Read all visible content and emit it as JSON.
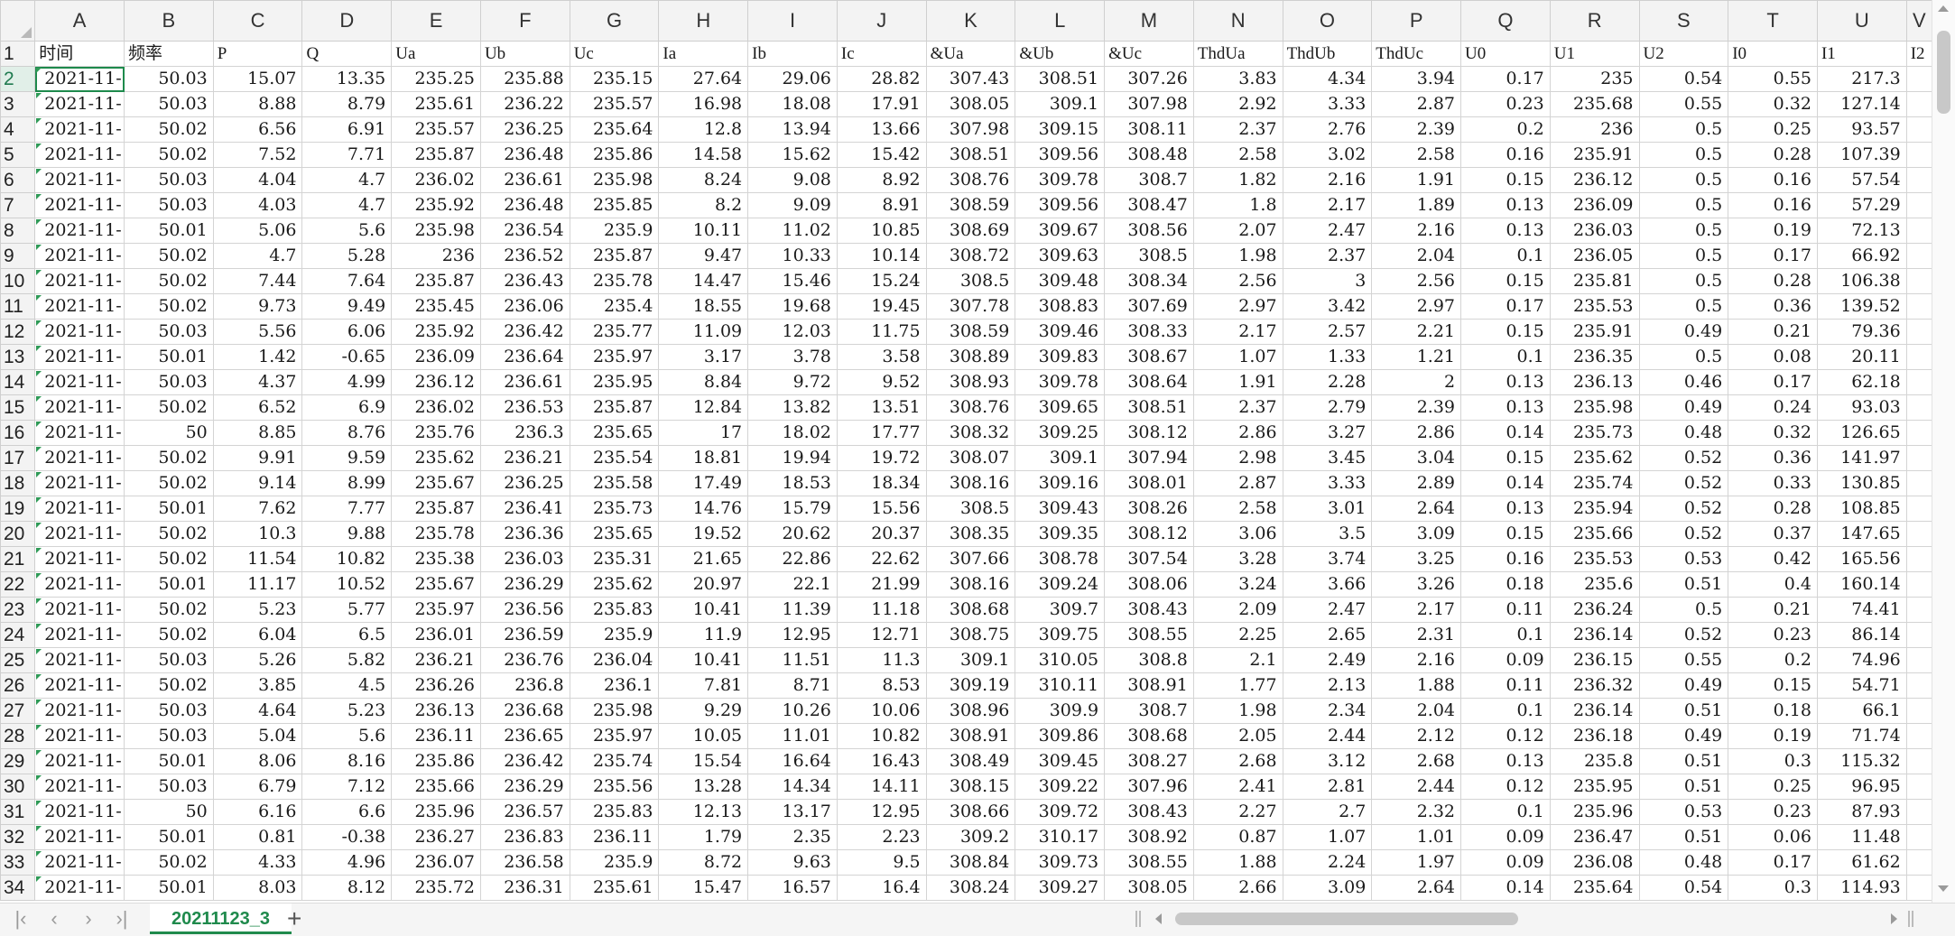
{
  "columns": [
    "A",
    "B",
    "C",
    "D",
    "E",
    "F",
    "G",
    "H",
    "I",
    "J",
    "K",
    "L",
    "M",
    "N",
    "O",
    "P",
    "Q",
    "R",
    "S",
    "T",
    "U",
    "V"
  ],
  "header_row": {
    "row": "1",
    "cells": [
      "时间",
      "频率",
      "P",
      "Q",
      "Ua",
      "Ub",
      "Uc",
      "Ia",
      "Ib",
      "Ic",
      "&Ua",
      "&Ub",
      "&Uc",
      "ThdUa",
      "ThdUb",
      "ThdUc",
      "U0",
      "U1",
      "U2",
      "I0",
      "I1",
      "I2"
    ]
  },
  "rows": [
    {
      "row": "2",
      "cells": [
        "2021-11-",
        "50.03",
        "15.07",
        "13.35",
        "235.25",
        "235.88",
        "235.15",
        "27.64",
        "29.06",
        "28.82",
        "307.43",
        "308.51",
        "307.26",
        "3.83",
        "4.34",
        "3.94",
        "0.17",
        "235",
        "0.54",
        "0.55",
        "217.3",
        ""
      ]
    },
    {
      "row": "3",
      "cells": [
        "2021-11-",
        "50.03",
        "8.88",
        "8.79",
        "235.61",
        "236.22",
        "235.57",
        "16.98",
        "18.08",
        "17.91",
        "308.05",
        "309.1",
        "307.98",
        "2.92",
        "3.33",
        "2.87",
        "0.23",
        "235.68",
        "0.55",
        "0.32",
        "127.14",
        ""
      ]
    },
    {
      "row": "4",
      "cells": [
        "2021-11-",
        "50.02",
        "6.56",
        "6.91",
        "235.57",
        "236.25",
        "235.64",
        "12.8",
        "13.94",
        "13.66",
        "307.98",
        "309.15",
        "308.11",
        "2.37",
        "2.76",
        "2.39",
        "0.2",
        "236",
        "0.5",
        "0.25",
        "93.57",
        ""
      ]
    },
    {
      "row": "5",
      "cells": [
        "2021-11-",
        "50.02",
        "7.52",
        "7.71",
        "235.87",
        "236.48",
        "235.86",
        "14.58",
        "15.62",
        "15.42",
        "308.51",
        "309.56",
        "308.48",
        "2.58",
        "3.02",
        "2.58",
        "0.16",
        "235.91",
        "0.5",
        "0.28",
        "107.39",
        ""
      ]
    },
    {
      "row": "6",
      "cells": [
        "2021-11-",
        "50.03",
        "4.04",
        "4.7",
        "236.02",
        "236.61",
        "235.98",
        "8.24",
        "9.08",
        "8.92",
        "308.76",
        "309.78",
        "308.7",
        "1.82",
        "2.16",
        "1.91",
        "0.15",
        "236.12",
        "0.5",
        "0.16",
        "57.54",
        ""
      ]
    },
    {
      "row": "7",
      "cells": [
        "2021-11-",
        "50.03",
        "4.03",
        "4.7",
        "235.92",
        "236.48",
        "235.85",
        "8.2",
        "9.09",
        "8.91",
        "308.59",
        "309.56",
        "308.47",
        "1.8",
        "2.17",
        "1.89",
        "0.13",
        "236.09",
        "0.5",
        "0.16",
        "57.29",
        ""
      ]
    },
    {
      "row": "8",
      "cells": [
        "2021-11-",
        "50.01",
        "5.06",
        "5.6",
        "235.98",
        "236.54",
        "235.9",
        "10.11",
        "11.02",
        "10.85",
        "308.69",
        "309.67",
        "308.56",
        "2.07",
        "2.47",
        "2.16",
        "0.13",
        "236.03",
        "0.5",
        "0.19",
        "72.13",
        ""
      ]
    },
    {
      "row": "9",
      "cells": [
        "2021-11-",
        "50.02",
        "4.7",
        "5.28",
        "236",
        "236.52",
        "235.87",
        "9.47",
        "10.33",
        "10.14",
        "308.72",
        "309.63",
        "308.5",
        "1.98",
        "2.37",
        "2.04",
        "0.1",
        "236.05",
        "0.5",
        "0.17",
        "66.92",
        ""
      ]
    },
    {
      "row": "10",
      "cells": [
        "2021-11-",
        "50.02",
        "7.44",
        "7.64",
        "235.87",
        "236.43",
        "235.78",
        "14.47",
        "15.46",
        "15.24",
        "308.5",
        "309.48",
        "308.34",
        "2.56",
        "3",
        "2.56",
        "0.15",
        "235.81",
        "0.5",
        "0.28",
        "106.38",
        ""
      ]
    },
    {
      "row": "11",
      "cells": [
        "2021-11-",
        "50.02",
        "9.73",
        "9.49",
        "235.45",
        "236.06",
        "235.4",
        "18.55",
        "19.68",
        "19.45",
        "307.78",
        "308.83",
        "307.69",
        "2.97",
        "3.42",
        "2.97",
        "0.17",
        "235.53",
        "0.5",
        "0.36",
        "139.52",
        ""
      ]
    },
    {
      "row": "12",
      "cells": [
        "2021-11-",
        "50.03",
        "5.56",
        "6.06",
        "235.92",
        "236.42",
        "235.77",
        "11.09",
        "12.03",
        "11.75",
        "308.59",
        "309.46",
        "308.33",
        "2.17",
        "2.57",
        "2.21",
        "0.15",
        "235.91",
        "0.49",
        "0.21",
        "79.36",
        ""
      ]
    },
    {
      "row": "13",
      "cells": [
        "2021-11-",
        "50.01",
        "1.42",
        "-0.65",
        "236.09",
        "236.64",
        "235.97",
        "3.17",
        "3.78",
        "3.58",
        "308.89",
        "309.83",
        "308.67",
        "1.07",
        "1.33",
        "1.21",
        "0.1",
        "236.35",
        "0.5",
        "0.08",
        "20.11",
        ""
      ]
    },
    {
      "row": "14",
      "cells": [
        "2021-11-",
        "50.03",
        "4.37",
        "4.99",
        "236.12",
        "236.61",
        "235.95",
        "8.84",
        "9.72",
        "9.52",
        "308.93",
        "309.78",
        "308.64",
        "1.91",
        "2.28",
        "2",
        "0.13",
        "236.13",
        "0.46",
        "0.17",
        "62.18",
        ""
      ]
    },
    {
      "row": "15",
      "cells": [
        "2021-11-",
        "50.02",
        "6.52",
        "6.9",
        "236.02",
        "236.53",
        "235.87",
        "12.84",
        "13.82",
        "13.51",
        "308.76",
        "309.65",
        "308.51",
        "2.37",
        "2.79",
        "2.39",
        "0.13",
        "235.98",
        "0.49",
        "0.24",
        "93.03",
        ""
      ]
    },
    {
      "row": "16",
      "cells": [
        "2021-11-",
        "50",
        "8.85",
        "8.76",
        "235.76",
        "236.3",
        "235.65",
        "17",
        "18.02",
        "17.77",
        "308.32",
        "309.25",
        "308.12",
        "2.86",
        "3.27",
        "2.86",
        "0.14",
        "235.73",
        "0.48",
        "0.32",
        "126.65",
        ""
      ]
    },
    {
      "row": "17",
      "cells": [
        "2021-11-",
        "50.02",
        "9.91",
        "9.59",
        "235.62",
        "236.21",
        "235.54",
        "18.81",
        "19.94",
        "19.72",
        "308.07",
        "309.1",
        "307.94",
        "2.98",
        "3.45",
        "3.04",
        "0.15",
        "235.62",
        "0.52",
        "0.36",
        "141.97",
        ""
      ]
    },
    {
      "row": "18",
      "cells": [
        "2021-11-",
        "50.02",
        "9.14",
        "8.99",
        "235.67",
        "236.25",
        "235.58",
        "17.49",
        "18.53",
        "18.34",
        "308.16",
        "309.16",
        "308.01",
        "2.87",
        "3.33",
        "2.89",
        "0.14",
        "235.74",
        "0.52",
        "0.33",
        "130.85",
        ""
      ]
    },
    {
      "row": "19",
      "cells": [
        "2021-11-",
        "50.01",
        "7.62",
        "7.77",
        "235.87",
        "236.41",
        "235.73",
        "14.76",
        "15.79",
        "15.56",
        "308.5",
        "309.43",
        "308.26",
        "2.58",
        "3.01",
        "2.64",
        "0.13",
        "235.94",
        "0.52",
        "0.28",
        "108.85",
        ""
      ]
    },
    {
      "row": "20",
      "cells": [
        "2021-11-",
        "50.02",
        "10.3",
        "9.88",
        "235.78",
        "236.36",
        "235.65",
        "19.52",
        "20.62",
        "20.37",
        "308.35",
        "309.35",
        "308.12",
        "3.06",
        "3.5",
        "3.09",
        "0.15",
        "235.66",
        "0.52",
        "0.37",
        "147.65",
        ""
      ]
    },
    {
      "row": "21",
      "cells": [
        "2021-11-",
        "50.02",
        "11.54",
        "10.82",
        "235.38",
        "236.03",
        "235.31",
        "21.65",
        "22.86",
        "22.62",
        "307.66",
        "308.78",
        "307.54",
        "3.28",
        "3.74",
        "3.25",
        "0.16",
        "235.53",
        "0.53",
        "0.42",
        "165.56",
        ""
      ]
    },
    {
      "row": "22",
      "cells": [
        "2021-11-",
        "50.01",
        "11.17",
        "10.52",
        "235.67",
        "236.29",
        "235.62",
        "20.97",
        "22.1",
        "21.99",
        "308.16",
        "309.24",
        "308.06",
        "3.24",
        "3.66",
        "3.26",
        "0.18",
        "235.6",
        "0.51",
        "0.4",
        "160.14",
        ""
      ]
    },
    {
      "row": "23",
      "cells": [
        "2021-11-",
        "50.02",
        "5.23",
        "5.77",
        "235.97",
        "236.56",
        "235.83",
        "10.41",
        "11.39",
        "11.18",
        "308.68",
        "309.7",
        "308.43",
        "2.09",
        "2.47",
        "2.17",
        "0.11",
        "236.24",
        "0.5",
        "0.21",
        "74.41",
        ""
      ]
    },
    {
      "row": "24",
      "cells": [
        "2021-11-",
        "50.02",
        "6.04",
        "6.5",
        "236.01",
        "236.59",
        "235.9",
        "11.9",
        "12.95",
        "12.71",
        "308.75",
        "309.75",
        "308.55",
        "2.25",
        "2.65",
        "2.31",
        "0.1",
        "236.14",
        "0.52",
        "0.23",
        "86.14",
        ""
      ]
    },
    {
      "row": "25",
      "cells": [
        "2021-11-",
        "50.03",
        "5.26",
        "5.82",
        "236.21",
        "236.76",
        "236.04",
        "10.41",
        "11.51",
        "11.3",
        "309.1",
        "310.05",
        "308.8",
        "2.1",
        "2.49",
        "2.16",
        "0.09",
        "236.15",
        "0.55",
        "0.2",
        "74.96",
        ""
      ]
    },
    {
      "row": "26",
      "cells": [
        "2021-11-",
        "50.02",
        "3.85",
        "4.5",
        "236.26",
        "236.8",
        "236.1",
        "7.81",
        "8.71",
        "8.53",
        "309.19",
        "310.11",
        "308.91",
        "1.77",
        "2.13",
        "1.88",
        "0.11",
        "236.32",
        "0.49",
        "0.15",
        "54.71",
        ""
      ]
    },
    {
      "row": "27",
      "cells": [
        "2021-11-",
        "50.03",
        "4.64",
        "5.23",
        "236.13",
        "236.68",
        "235.98",
        "9.29",
        "10.26",
        "10.06",
        "308.96",
        "309.9",
        "308.7",
        "1.98",
        "2.34",
        "2.04",
        "0.1",
        "236.14",
        "0.51",
        "0.18",
        "66.1",
        ""
      ]
    },
    {
      "row": "28",
      "cells": [
        "2021-11-",
        "50.03",
        "5.04",
        "5.6",
        "236.11",
        "236.65",
        "235.97",
        "10.05",
        "11.01",
        "10.82",
        "308.91",
        "309.86",
        "308.68",
        "2.05",
        "2.44",
        "2.12",
        "0.12",
        "236.18",
        "0.49",
        "0.19",
        "71.74",
        ""
      ]
    },
    {
      "row": "29",
      "cells": [
        "2021-11-",
        "50.01",
        "8.06",
        "8.16",
        "235.86",
        "236.42",
        "235.74",
        "15.54",
        "16.64",
        "16.43",
        "308.49",
        "309.45",
        "308.27",
        "2.68",
        "3.12",
        "2.68",
        "0.13",
        "235.8",
        "0.51",
        "0.3",
        "115.32",
        ""
      ]
    },
    {
      "row": "30",
      "cells": [
        "2021-11-",
        "50.03",
        "6.79",
        "7.12",
        "235.66",
        "236.29",
        "235.56",
        "13.28",
        "14.34",
        "14.11",
        "308.15",
        "309.22",
        "307.96",
        "2.41",
        "2.81",
        "2.44",
        "0.12",
        "235.95",
        "0.51",
        "0.25",
        "96.95",
        ""
      ]
    },
    {
      "row": "31",
      "cells": [
        "2021-11-",
        "50",
        "6.16",
        "6.6",
        "235.96",
        "236.57",
        "235.83",
        "12.13",
        "13.17",
        "12.95",
        "308.66",
        "309.72",
        "308.43",
        "2.27",
        "2.7",
        "2.32",
        "0.1",
        "235.96",
        "0.53",
        "0.23",
        "87.93",
        ""
      ]
    },
    {
      "row": "32",
      "cells": [
        "2021-11-",
        "50.01",
        "0.81",
        "-0.38",
        "236.27",
        "236.83",
        "236.11",
        "1.79",
        "2.35",
        "2.23",
        "309.2",
        "310.17",
        "308.92",
        "0.87",
        "1.07",
        "1.01",
        "0.09",
        "236.47",
        "0.51",
        "0.06",
        "11.48",
        ""
      ]
    },
    {
      "row": "33",
      "cells": [
        "2021-11-",
        "50.02",
        "4.33",
        "4.96",
        "236.07",
        "236.58",
        "235.9",
        "8.72",
        "9.63",
        "9.5",
        "308.84",
        "309.73",
        "308.55",
        "1.88",
        "2.24",
        "1.97",
        "0.09",
        "236.08",
        "0.48",
        "0.17",
        "61.62",
        ""
      ]
    },
    {
      "row": "34",
      "cells": [
        "2021-11-",
        "50.01",
        "8.03",
        "8.12",
        "235.72",
        "236.31",
        "235.61",
        "15.47",
        "16.57",
        "16.4",
        "308.24",
        "309.27",
        "308.05",
        "2.66",
        "3.09",
        "2.64",
        "0.14",
        "235.64",
        "0.54",
        "0.3",
        "114.93",
        ""
      ]
    }
  ],
  "sheet_tab": {
    "label": "20211123_3"
  },
  "nav": {
    "first_icon": "first-sheet-icon",
    "prev_icon": "prev-sheet-icon",
    "next_icon": "next-sheet-icon",
    "last_icon": "last-sheet-icon",
    "add_icon": "add-sheet-icon"
  },
  "colors": {
    "accent": "#1f8a4c",
    "header_bg": "#f3f3f3",
    "gridline": "#d4d4d4",
    "active_row_bg": "#e1efe8"
  }
}
